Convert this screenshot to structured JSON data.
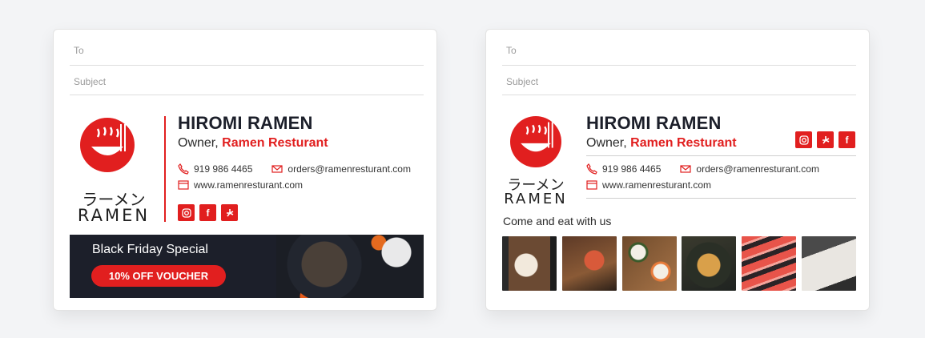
{
  "compose": {
    "to_placeholder": "To",
    "subject_placeholder": "Subject"
  },
  "signature": {
    "logo_japanese": "ラーメン",
    "logo_latin": "RAMEN",
    "name": "HIROMI RAMEN",
    "role_prefix": "Owner,",
    "company": "Ramen Resturant",
    "phone": "919 986 4465",
    "email": "orders@ramenresturant.com",
    "website": "www.ramenresturant.com",
    "social_icons": [
      "instagram-icon",
      "facebook-icon",
      "yelp-icon"
    ]
  },
  "banner": {
    "title": "Black Friday Special",
    "voucher": "10% OFF VOUCHER"
  },
  "gallery": {
    "caption": "Come and eat with us",
    "photos": 6
  },
  "colors": {
    "brand_red": "#e11f1f",
    "navy": "#1c1f2a",
    "page_bg": "#f3f4f6"
  }
}
